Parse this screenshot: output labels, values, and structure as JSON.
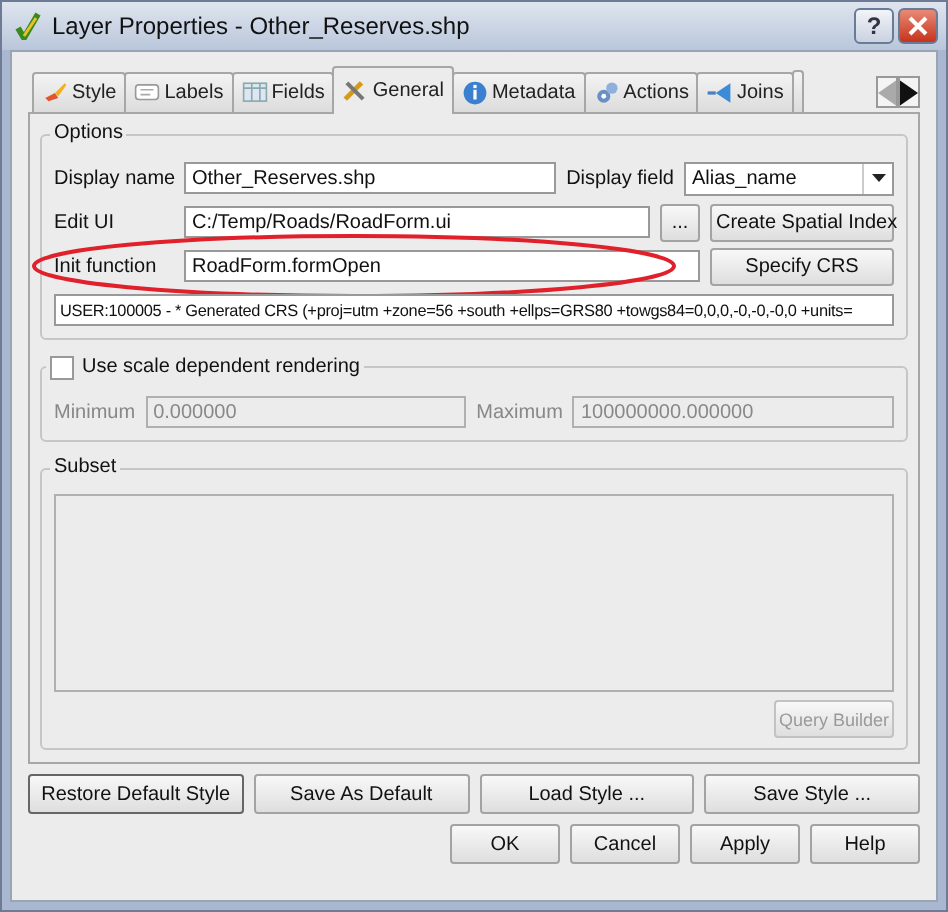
{
  "window": {
    "title": "Layer Properties - Other_Reserves.shp",
    "help_button": "?"
  },
  "tabs": [
    {
      "label": "Style",
      "selected": false
    },
    {
      "label": "Labels",
      "selected": false
    },
    {
      "label": "Fields",
      "selected": false
    },
    {
      "label": "General",
      "selected": true
    },
    {
      "label": "Metadata",
      "selected": false
    },
    {
      "label": "Actions",
      "selected": false
    },
    {
      "label": "Joins",
      "selected": false
    }
  ],
  "options": {
    "title": "Options",
    "display_name": {
      "label": "Display name",
      "value": "Other_Reserves.shp"
    },
    "display_field": {
      "label": "Display field",
      "value": "Alias_name"
    },
    "edit_ui": {
      "label": "Edit UI",
      "value": "C:/Temp/Roads/RoadForm.ui",
      "browse": "..."
    },
    "create_index_button": "Create Spatial Index",
    "init_function": {
      "label": "Init function",
      "value": "RoadForm.formOpen"
    },
    "specify_crs_button": "Specify CRS",
    "crs": "USER:100005 -  * Generated CRS (+proj=utm +zone=56 +south +ellps=GRS80 +towgs84=0,0,0,-0,-0,-0,0 +units="
  },
  "scale": {
    "label": "Use scale dependent rendering",
    "checked": false,
    "minimum": {
      "label": "Minimum",
      "value": "0.000000",
      "disabled": true
    },
    "maximum": {
      "label": "Maximum",
      "value": "100000000.000000",
      "disabled": true
    }
  },
  "subset": {
    "title": "Subset",
    "query_builder": {
      "label": "Query Builder",
      "disabled": true
    }
  },
  "style_buttons": [
    "Restore Default Style",
    "Save As Default",
    "Load Style ...",
    "Save Style ..."
  ],
  "dialog_buttons": [
    "OK",
    "Cancel",
    "Apply",
    "Help"
  ]
}
